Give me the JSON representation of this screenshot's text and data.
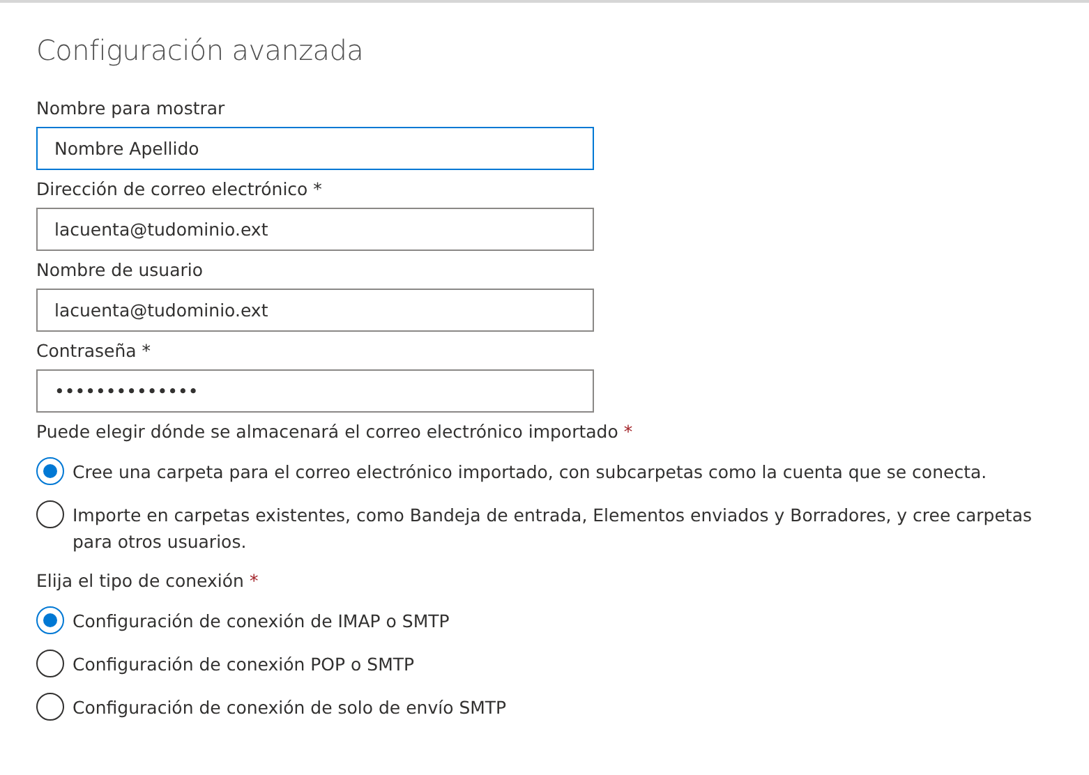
{
  "title": "Configuración avanzada",
  "fields": [
    {
      "label": "Nombre para mostrar",
      "value": "Nombre Apellido",
      "focused": true
    },
    {
      "label": "Dirección de correo electrónico *",
      "value": "lacuenta@tudominio.ext",
      "focused": false
    },
    {
      "label": "Nombre de usuario",
      "value": "lacuenta@tudominio.ext",
      "focused": false
    },
    {
      "label": "Contraseña *",
      "value": "••••••••••••••",
      "focused": false
    }
  ],
  "radio_groups": [
    {
      "label": "Puede elegir dónde se almacenará el correo electrónico importado",
      "required_mark": "*",
      "options": [
        {
          "label": "Cree una carpeta para el correo electrónico importado, con subcarpetas como la cuenta que se conecta.",
          "selected": true
        },
        {
          "label": "Importe en carpetas existentes, como Bandeja de entrada, Elementos enviados y Borradores, y cree carpetas para otros usuarios.",
          "selected": false
        }
      ]
    },
    {
      "label": "Elija el tipo de conexión",
      "required_mark": "*",
      "options": [
        {
          "label": "Configuración de conexión de IMAP o SMTP",
          "selected": true
        },
        {
          "label": "Configuración de conexión POP o SMTP",
          "selected": false
        },
        {
          "label": "Configuración de conexión de solo de envío SMTP",
          "selected": false
        }
      ]
    }
  ]
}
